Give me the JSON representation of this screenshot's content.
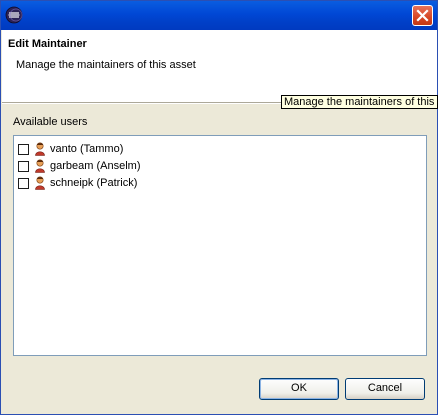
{
  "header": {
    "title": "Edit Maintainer",
    "description": "Manage the maintainers of this asset"
  },
  "tooltip": {
    "text": "Manage the maintainers of this asset"
  },
  "users": {
    "label": "Available users",
    "items": [
      {
        "label": "vanto (Tammo)",
        "checked": false
      },
      {
        "label": "garbeam (Anselm)",
        "checked": false
      },
      {
        "label": "schneipk (Patrick)",
        "checked": false
      }
    ]
  },
  "buttons": {
    "ok": "OK",
    "cancel": "Cancel"
  },
  "colors": {
    "titlebar": "#0047d5",
    "close": "#d64625"
  },
  "icons": {
    "app": "eclipse-icon",
    "close": "close-icon",
    "user": "user-icon"
  }
}
